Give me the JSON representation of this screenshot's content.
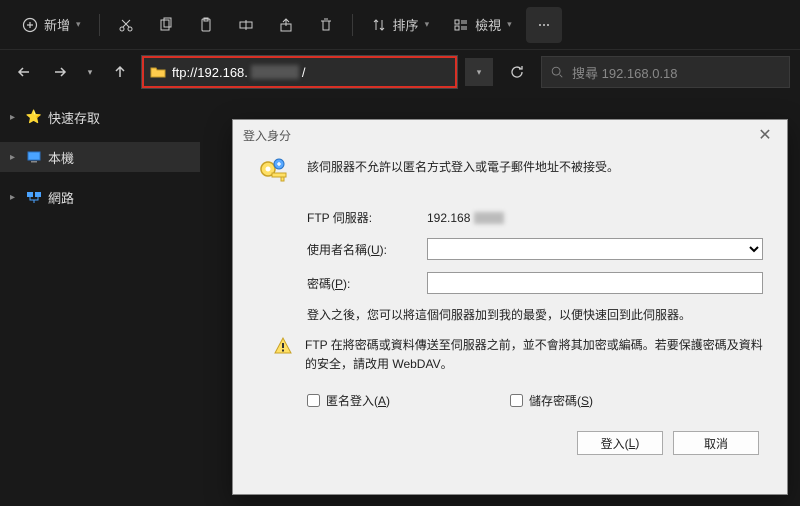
{
  "toolbar": {
    "new_label": "新增",
    "sort_label": "排序",
    "view_label": "檢視"
  },
  "address": {
    "prefix": "ftp://192.168.",
    "suffix": "/"
  },
  "search": {
    "placeholder": "搜尋 192.168.0.18"
  },
  "sidebar": {
    "items": [
      {
        "label": "快速存取"
      },
      {
        "label": "本機"
      },
      {
        "label": "網路"
      }
    ]
  },
  "dialog": {
    "title": "登入身分",
    "message": "該伺服器不允許以匿名方式登入或電子郵件地址不被接受。",
    "server_label": "FTP 伺服器:",
    "server_value_prefix": "192.168",
    "user_label_pre": "使用者名稱(",
    "user_label_u": "U",
    "user_label_post": "):",
    "pass_label_pre": "密碼(",
    "pass_label_u": "P",
    "pass_label_post": "):",
    "hint": "登入之後，您可以將這個伺服器加到我的最愛，以便快速回到此伺服器。",
    "warning": "FTP 在將密碼或資料傳送至伺服器之前，並不會將其加密或編碼。若要保護密碼及資料的安全，請改用 WebDAV。",
    "anon_pre": "匿名登入(",
    "anon_u": "A",
    "anon_post": ")",
    "save_pre": "儲存密碼(",
    "save_u": "S",
    "save_post": ")",
    "login_pre": "登入(",
    "login_u": "L",
    "login_post": ")",
    "cancel": "取消"
  }
}
